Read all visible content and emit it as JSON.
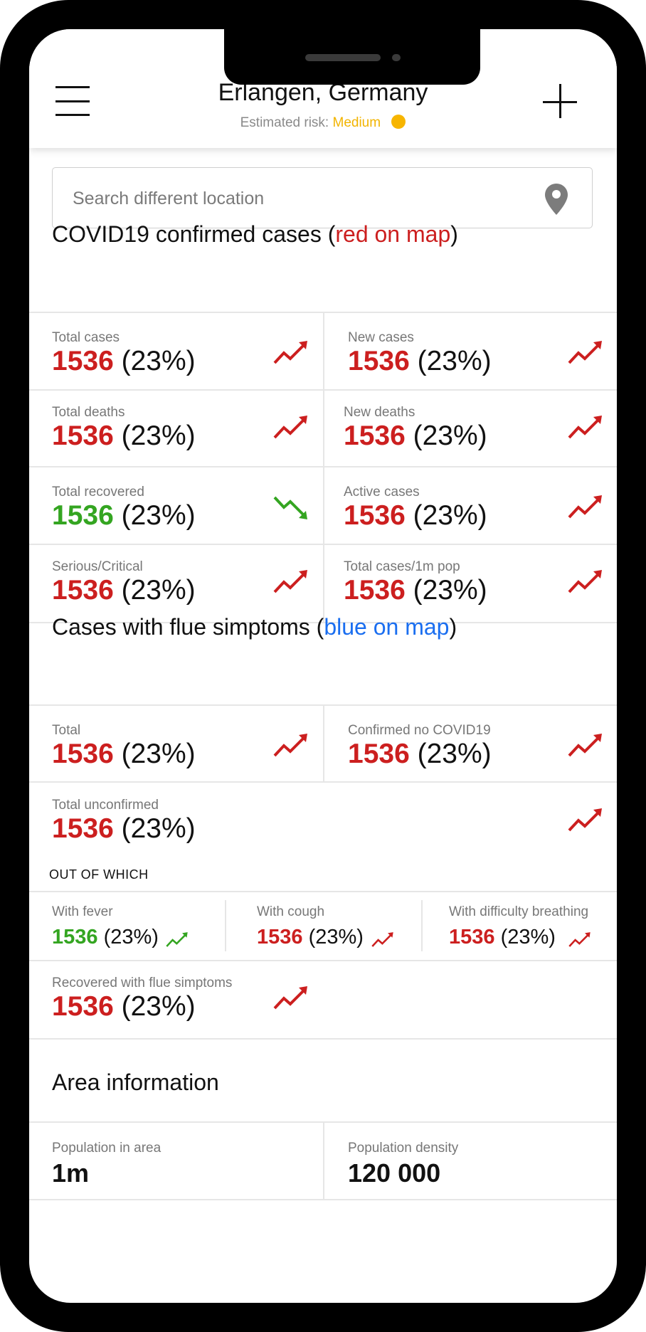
{
  "header": {
    "location": "Erlangen, Germany",
    "risk_label": "Estimated risk:",
    "risk_value": "Medium",
    "risk_color": "#f7b500"
  },
  "search": {
    "placeholder": "Search different location",
    "value": ""
  },
  "covid": {
    "title_prefix": "COVID19 confirmed cases (",
    "title_highlight": "red on map",
    "title_suffix": ")",
    "cells": [
      {
        "label": "Total cases",
        "value": "1536",
        "percent": "(23%)",
        "trend": "up",
        "color": "red"
      },
      {
        "label": "New cases",
        "value": "1536",
        "percent": "(23%)",
        "trend": "up",
        "color": "red"
      },
      {
        "label": "Total deaths",
        "value": "1536",
        "percent": "(23%)",
        "trend": "up",
        "color": "red"
      },
      {
        "label": "New deaths",
        "value": "1536",
        "percent": "(23%)",
        "trend": "up",
        "color": "red"
      },
      {
        "label": "Total recovered",
        "value": "1536",
        "percent": "(23%)",
        "trend": "down",
        "color": "green"
      },
      {
        "label": "Active cases",
        "value": "1536",
        "percent": "(23%)",
        "trend": "up",
        "color": "red"
      },
      {
        "label": "Serious/Critical",
        "value": "1536",
        "percent": "(23%)",
        "trend": "up",
        "color": "red"
      },
      {
        "label": "Total cases/1m pop",
        "value": "1536",
        "percent": "(23%)",
        "trend": "up",
        "color": "red"
      }
    ]
  },
  "flu": {
    "title_prefix": "Cases with flue simptoms (",
    "title_highlight": "blue on map",
    "title_suffix": ")",
    "total": {
      "label": "Total",
      "value": "1536",
      "percent": "(23%)"
    },
    "confirmed_no": {
      "label": "Confirmed no COVID19",
      "value": "1536",
      "percent": "(23%)"
    },
    "unconfirmed": {
      "label": "Total unconfirmed",
      "value": "1536",
      "percent": "(23%)"
    },
    "out_of_which": "OUT OF WHICH",
    "sub": [
      {
        "label": "With fever",
        "value": "1536",
        "percent": "(23%)",
        "color": "green"
      },
      {
        "label": "With cough",
        "value": "1536",
        "percent": "(23%)",
        "color": "red"
      },
      {
        "label": "With difficulty breathing",
        "value": "1536",
        "percent": "(23%)",
        "color": "red"
      }
    ],
    "recovered": {
      "label": "Recovered with flue simptoms",
      "value": "1536",
      "percent": "(23%)"
    }
  },
  "area": {
    "title": "Area information",
    "population_label": "Population in area",
    "population_value": "1m",
    "density_label": "Population density",
    "density_value": "120 000"
  },
  "colors": {
    "red": "#cc1f1f",
    "green": "#34a521",
    "blue": "#1a6ef0"
  }
}
